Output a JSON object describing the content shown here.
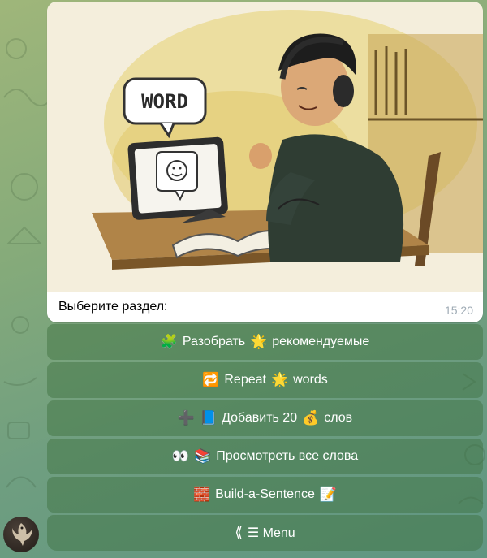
{
  "message": {
    "image_alt": "WORD",
    "image_text": "WORD",
    "caption": "Выберите раздел:",
    "time": "15:20"
  },
  "keyboard": [
    {
      "icon_left": "puzzle-icon",
      "text": "Разобрать",
      "icon_mid": "star-icon",
      "text2": "рекомендуемые"
    },
    {
      "icon_left": "repeat-icon",
      "text": "Repeat",
      "icon_mid": "star-icon",
      "text2": "words"
    },
    {
      "icon_left": "plus-book-icon",
      "text": "Добавить 20",
      "icon_mid": "money-bag-icon",
      "text2": "слов"
    },
    {
      "icon_left": "eyes-books-icon",
      "text": "Просмотреть все слова"
    },
    {
      "icon_left": "bricks-icon",
      "text": "Build-a-Sentence",
      "icon_right": "memo-icon"
    },
    {
      "icon_left": "back-arrows-icon",
      "text": "☰ Menu"
    }
  ],
  "colors": {
    "bubble_bg": "#ffffff",
    "button_bg": "#4e7f4e",
    "time_color": "#a0acb6"
  }
}
